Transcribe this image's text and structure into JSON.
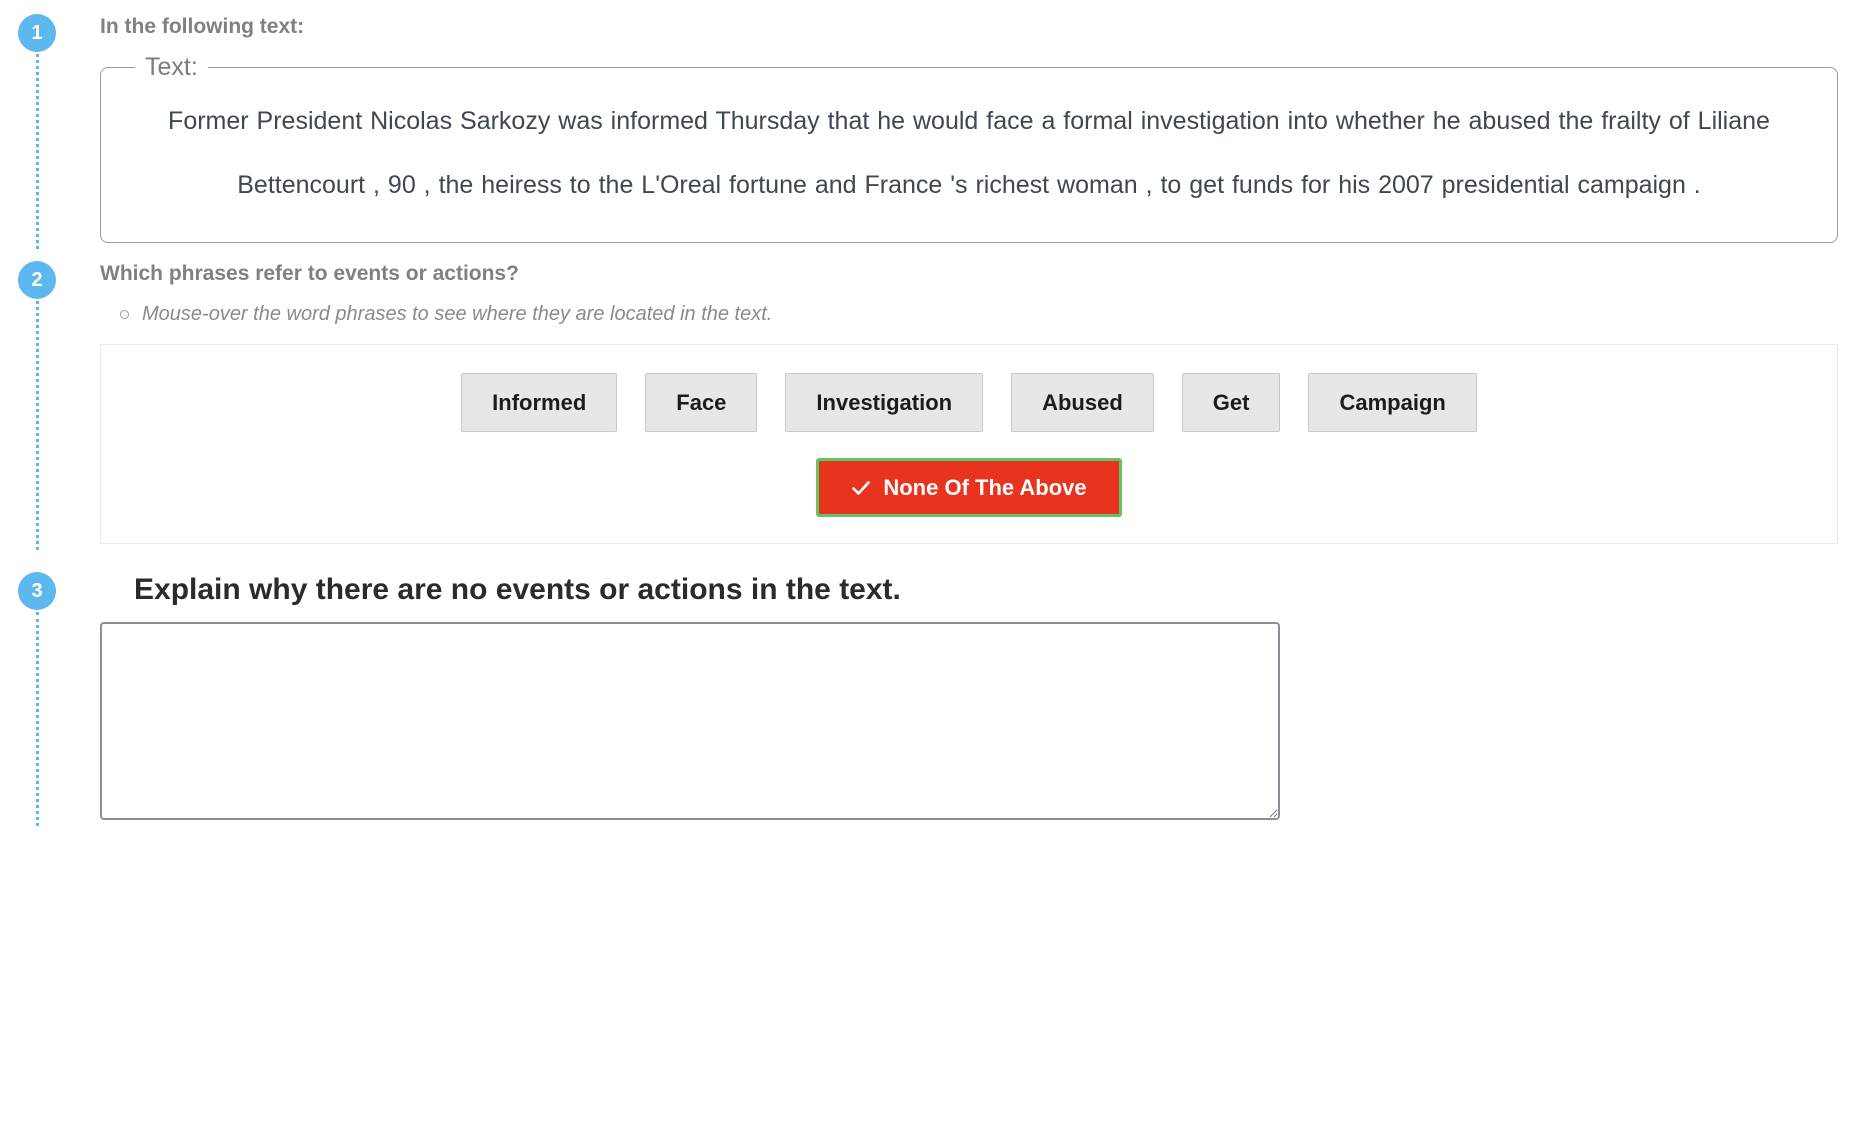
{
  "steps": {
    "one": {
      "number": "1"
    },
    "two": {
      "number": "2"
    },
    "three": {
      "number": "3"
    }
  },
  "step1": {
    "question": "In the following text:",
    "fieldset_legend": "Text:",
    "passage": "Former President Nicolas Sarkozy was informed Thursday that he would face a formal investigation into whether he abused the frailty of Liliane Bettencourt , 90 , the heiress to the L'Oreal fortune and France 's richest woman , to get funds for his 2007 presidential campaign ."
  },
  "step2": {
    "question": "Which phrases refer to events or actions?",
    "hint": "Mouse-over the word phrases to see where they are located in the text.",
    "phrases": [
      {
        "label": "Informed",
        "selected": false
      },
      {
        "label": "Face",
        "selected": false
      },
      {
        "label": "Investigation",
        "selected": false
      },
      {
        "label": "Abused",
        "selected": false
      },
      {
        "label": "Get",
        "selected": false
      },
      {
        "label": "Campaign",
        "selected": false
      }
    ],
    "none_of_the_above": {
      "label": "None Of The Above",
      "icon": "check-icon",
      "selected": true
    }
  },
  "step3": {
    "title": "Explain why there are no events or actions in the text.",
    "explanation_value": "",
    "explanation_placeholder": ""
  },
  "colors": {
    "badge_blue": "#5cb8ee",
    "selected_red": "#e8341f",
    "selected_border_green": "#62c462",
    "phrase_gray": "#e7e7e7",
    "label_gray": "#808080",
    "passage_text": "#3d4852"
  }
}
